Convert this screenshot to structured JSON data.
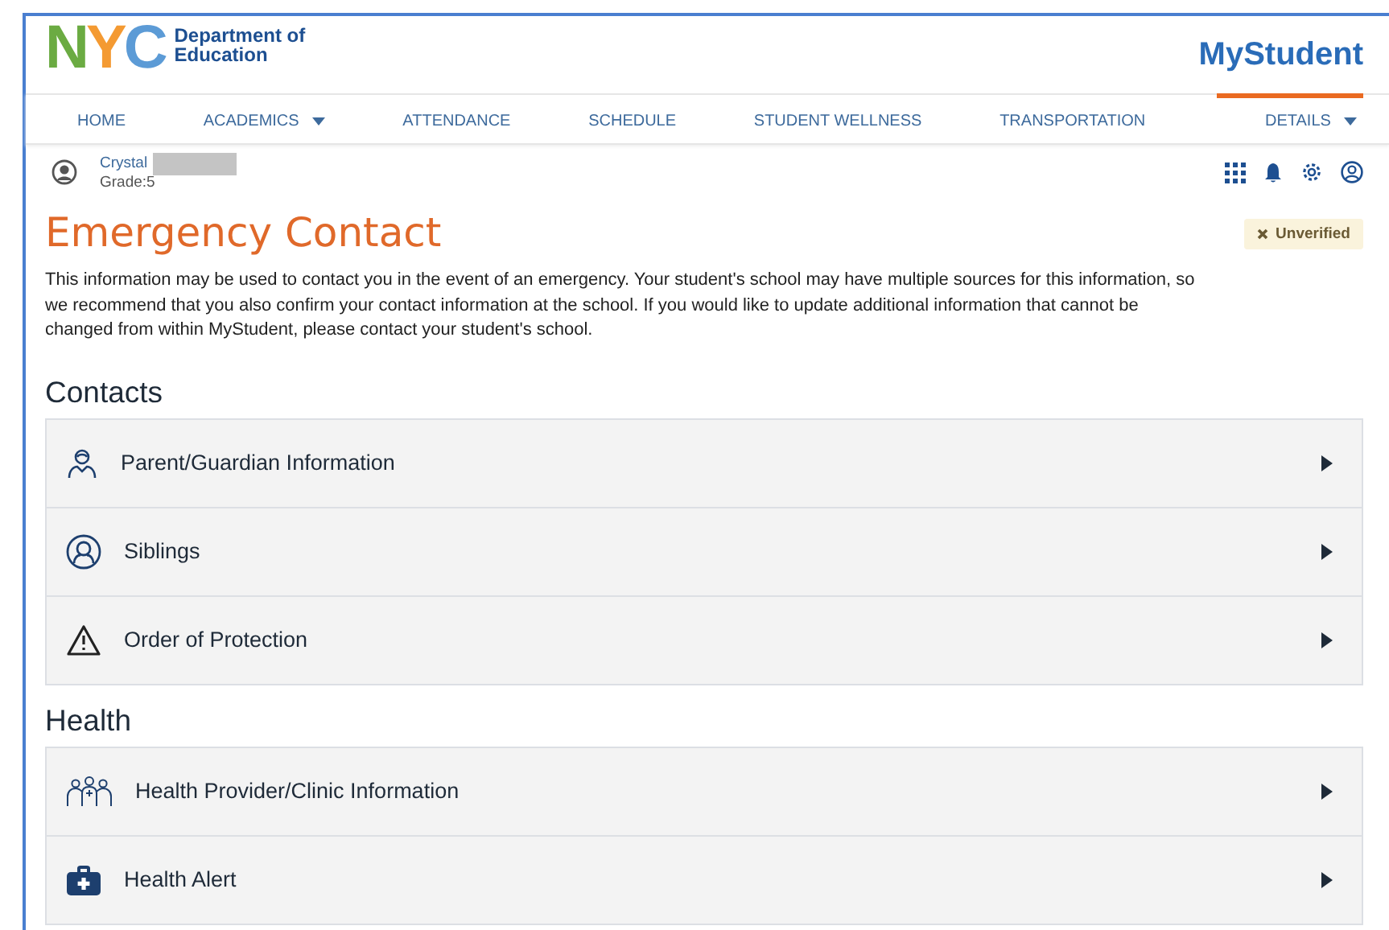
{
  "header": {
    "logo": "NYC",
    "department": [
      "Department of",
      "Education"
    ],
    "app_title": "MyStudent"
  },
  "nav": [
    {
      "label": "HOME",
      "dropdown": false,
      "selected": false
    },
    {
      "label": "ACADEMICS",
      "dropdown": true,
      "selected": false
    },
    {
      "label": "ATTENDANCE",
      "dropdown": false,
      "selected": false
    },
    {
      "label": "SCHEDULE",
      "dropdown": false,
      "selected": false
    },
    {
      "label": "STUDENT WELLNESS",
      "dropdown": false,
      "selected": false
    },
    {
      "label": "TRANSPORTATION",
      "dropdown": false,
      "selected": false
    },
    {
      "label": "DETAILS",
      "dropdown": true,
      "selected": true
    }
  ],
  "student": {
    "name": "Crystal",
    "grade": "Grade:5",
    "redacted": true
  },
  "page": {
    "title": "Emergency Contact",
    "status": "Unverified",
    "description": "This information may be used to contact you in the event of an emergency. Your student's school may have multiple sources for this information, so we recommend that you also confirm your contact information at the school. If you would like to update additional information that cannot be changed from within MyStudent, please contact your student's school."
  },
  "sections": [
    {
      "heading": "Contacts",
      "items": [
        {
          "label": "Parent/Guardian Information"
        },
        {
          "label": "Siblings"
        },
        {
          "label": "Order of Protection"
        }
      ]
    },
    {
      "heading": "Health",
      "items": [
        {
          "label": "Health Provider/Clinic Information"
        },
        {
          "label": "Health Alert"
        }
      ]
    }
  ]
}
